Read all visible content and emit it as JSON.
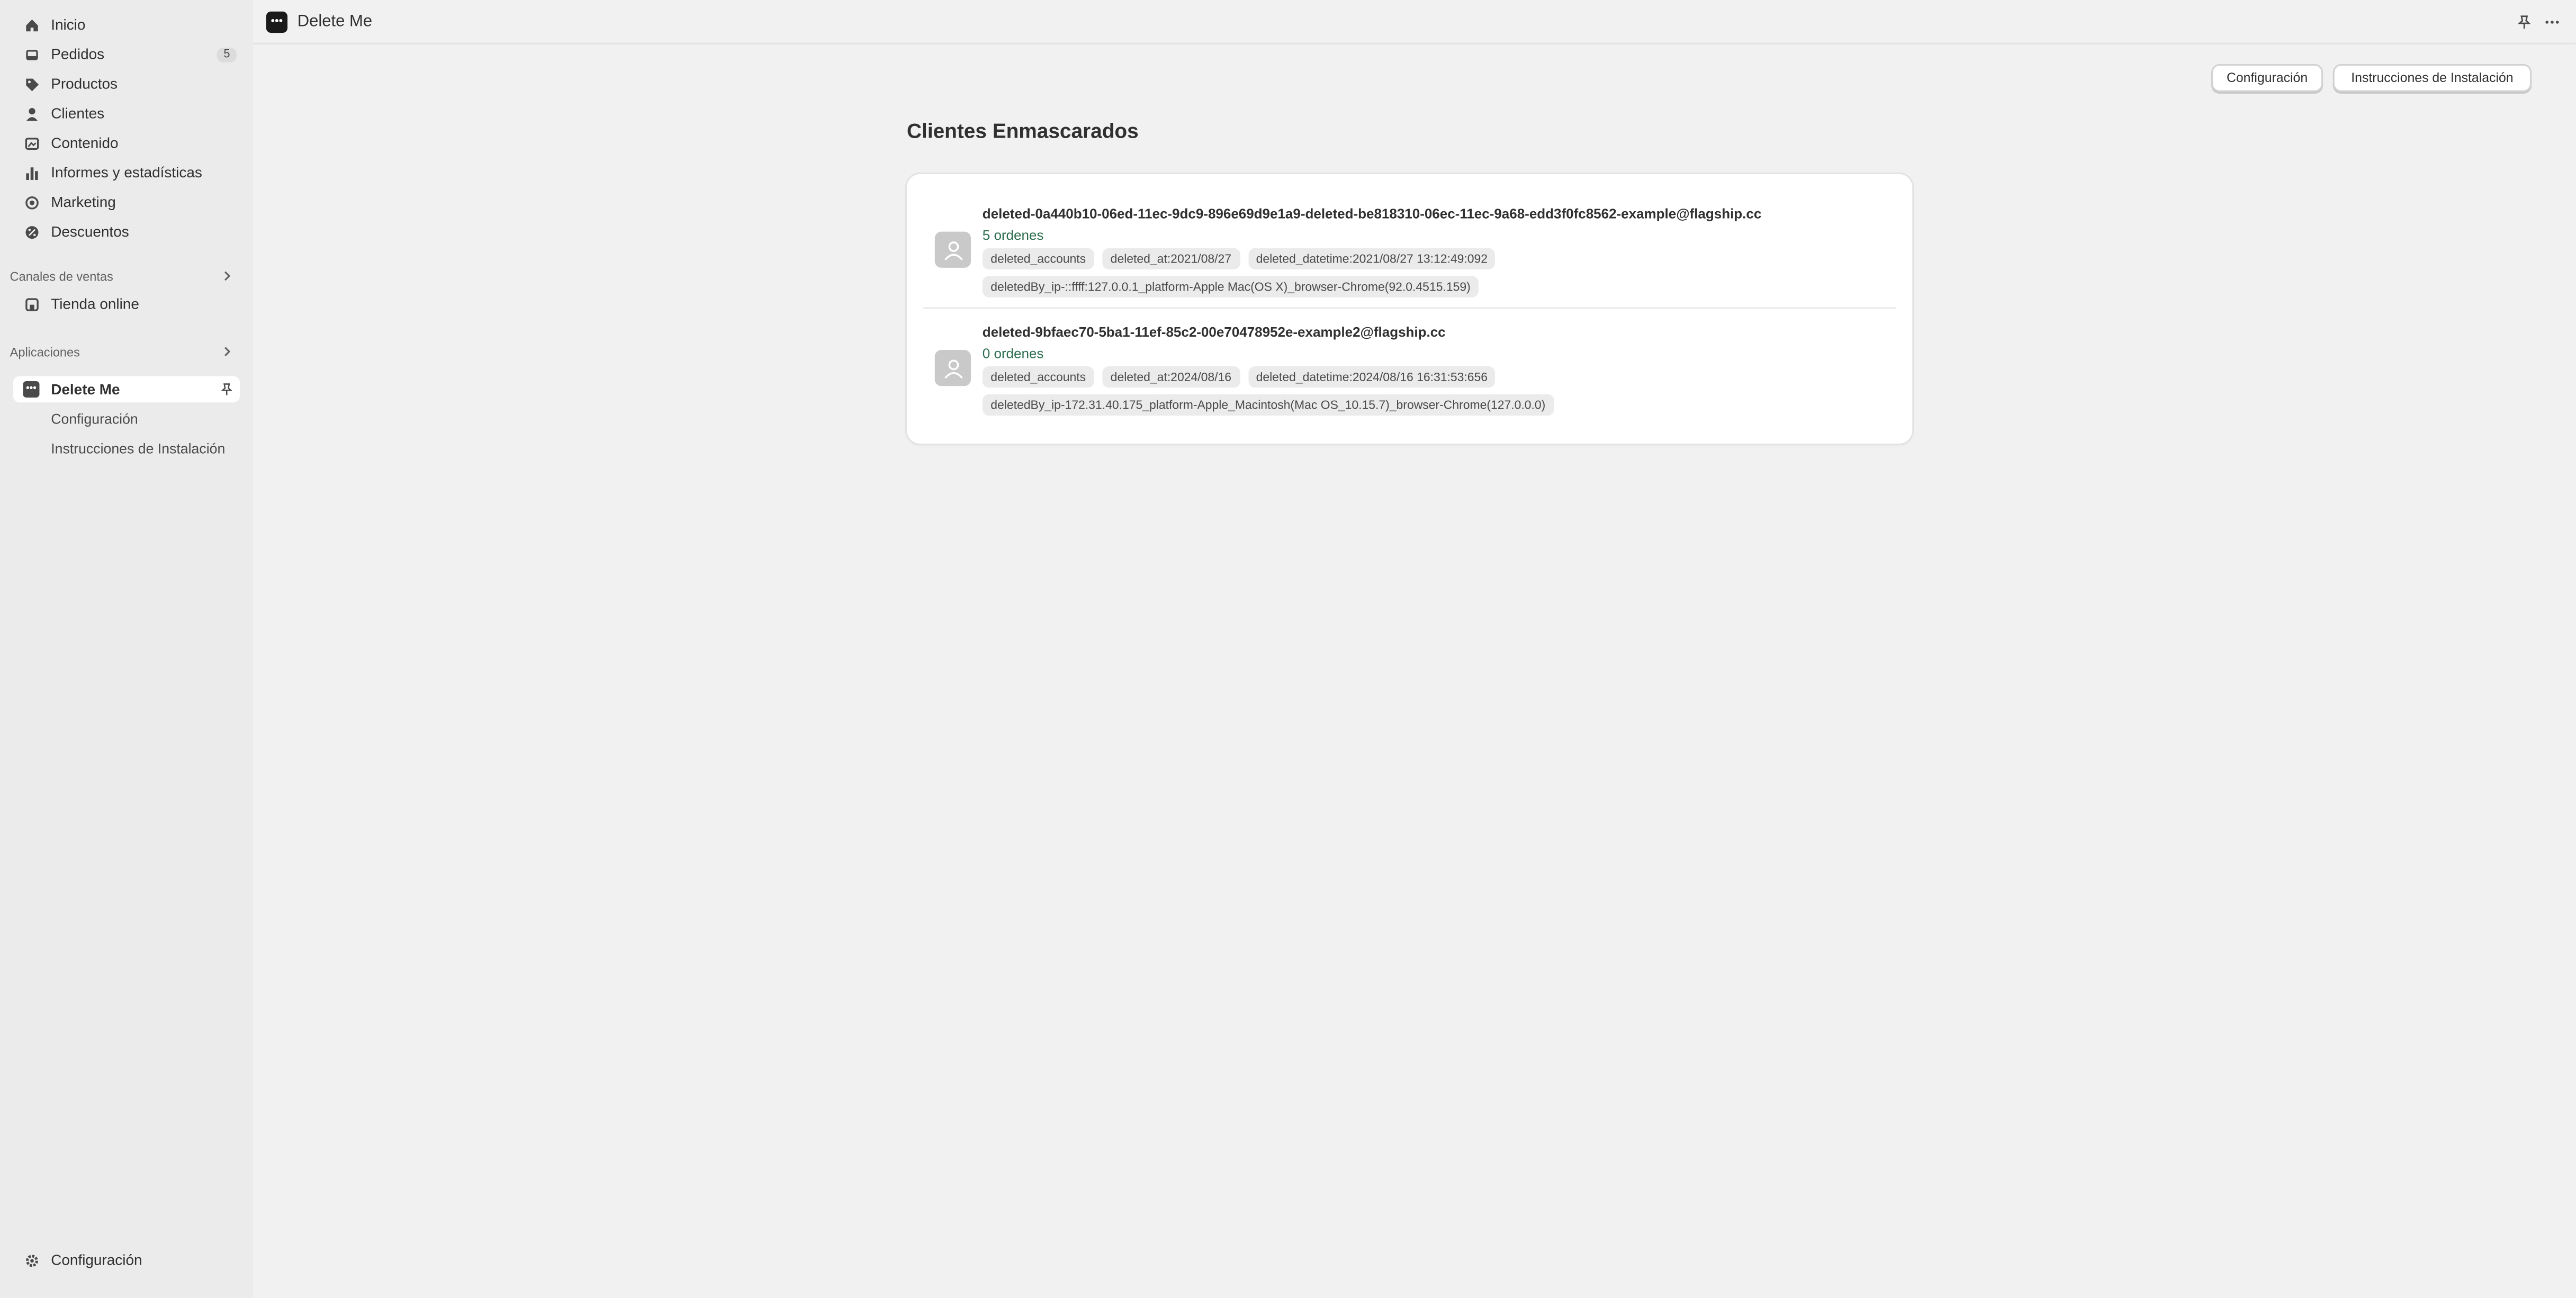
{
  "sidebar": {
    "items": [
      {
        "label": "Inicio",
        "icon": "home-icon"
      },
      {
        "label": "Pedidos",
        "icon": "inbox-icon",
        "badge": "5"
      },
      {
        "label": "Productos",
        "icon": "tag-icon"
      },
      {
        "label": "Clientes",
        "icon": "person-icon"
      },
      {
        "label": "Contenido",
        "icon": "content-icon"
      },
      {
        "label": "Informes y estadísticas",
        "icon": "bar-chart-icon"
      },
      {
        "label": "Marketing",
        "icon": "target-icon"
      },
      {
        "label": "Descuentos",
        "icon": "discount-icon"
      }
    ],
    "sales_channels_title": "Canales de ventas",
    "online_store": "Tienda online",
    "apps_title": "Aplicaciones",
    "app_name": "Delete Me",
    "app_sub_items": [
      "Configuración",
      "Instrucciones de Instalación"
    ],
    "settings_label": "Configuración"
  },
  "topbar": {
    "app_icon_text": "•••",
    "title": "Delete Me"
  },
  "actions": {
    "config_label": "Configuración",
    "install_label": "Instrucciones de Instalación"
  },
  "page": {
    "title": "Clientes Enmascarados"
  },
  "customers": [
    {
      "email": "deleted-0a440b10-06ed-11ec-9dc9-896e69d9e1a9-deleted-be818310-06ec-11ec-9a68-edd3f0fc8562-example@flagship.cc",
      "orders": "5 ordenes",
      "tags_row1": [
        "deleted_accounts",
        "deleted_at:2021/08/27",
        "deleted_datetime:2021/08/27 13:12:49:092"
      ],
      "tags_row2": [
        "deletedBy_ip-::ffff:127.0.0.1_platform-Apple Mac(OS X)_browser-Chrome(92.0.4515.159)"
      ]
    },
    {
      "email": "deleted-9bfaec70-5ba1-11ef-85c2-00e70478952e-example2@flagship.cc",
      "orders": "0 ordenes",
      "tags_row1": [
        "deleted_accounts",
        "deleted_at:2024/08/16",
        "deleted_datetime:2024/08/16 16:31:53:656"
      ],
      "tags_row2": [
        "deletedBy_ip-172.31.40.175_platform-Apple_Macintosh(Mac OS_10.15.7)_browser-Chrome(127.0.0.0)"
      ]
    }
  ]
}
